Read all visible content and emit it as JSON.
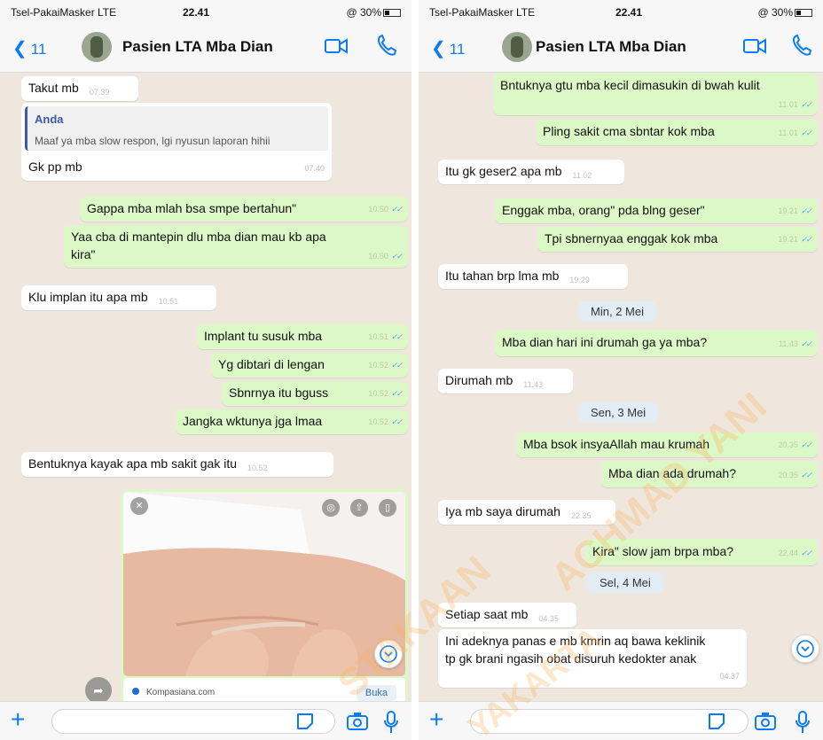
{
  "colors": {
    "accent": "#0b7cf4",
    "bubble_out": "#dcf8c6",
    "bubble_in": "#ffffff",
    "chat_bg": "#efe7de",
    "read_ticks": "#45a6f0"
  },
  "status": {
    "carrier": "Tsel-PakaiMasker  LTE",
    "time": "22.41",
    "battery": "@ 30%"
  },
  "header": {
    "back_count": "11",
    "title": "Pasien LTA Mba Dian"
  },
  "ticks": "✓✓",
  "left": {
    "m1": {
      "text": "Takut mb",
      "time": "07.39"
    },
    "quote": {
      "author": "Anda",
      "text": "Maaf ya mba slow respon, lgi nyusun laporan hihii"
    },
    "m2": {
      "text": "Gk pp mb",
      "time": "07.40"
    },
    "m3": {
      "text": "Gappa mba mlah bsa smpe bertahun\"",
      "time": "10.50"
    },
    "m4": {
      "line1": "Yaa cba di mantepin dlu mba dian mau kb apa",
      "line2": "kira\"",
      "time": "10.50"
    },
    "m5": {
      "text": "Klu implan itu apa mb",
      "time": "10.51"
    },
    "m6": {
      "text": "Implant tu susuk mba",
      "time": "10.51"
    },
    "m7": {
      "text": "Yg dibtari di lengan",
      "time": "10.52"
    },
    "m8": {
      "text": "Sbnrnya itu bguss",
      "time": "10.52"
    },
    "m9": {
      "text": "Jangka wktunya jga lmaa",
      "time": "10.52"
    },
    "m10": {
      "text": "Bentuknya kayak apa mb sakit gak itu",
      "time": "10.52"
    },
    "link": {
      "source": "Kompasiana.com",
      "button": "Buka"
    }
  },
  "right": {
    "r1": {
      "text": "Bntuknya gtu mba kecil dimasukin di bwah kulit",
      "time": "11.01"
    },
    "r2": {
      "text": "Pling sakit cma sbntar kok mba",
      "time": "11.01"
    },
    "r3": {
      "text": "Itu gk geser2 apa mb",
      "time": "11.02"
    },
    "r4": {
      "text": "Enggak mba, orang\" pda blng geser\"",
      "time": "19.21"
    },
    "r5": {
      "text": "Tpi sbnernyaa enggak kok mba",
      "time": "19.21"
    },
    "r6": {
      "text": "Itu tahan brp lma mb",
      "time": "19.29"
    },
    "d1": "Min, 2 Mei",
    "r7": {
      "text": "Mba dian hari ini drumah ga ya mba?",
      "time": "11.43"
    },
    "r8": {
      "text": "Dirumah mb",
      "time": "11.43"
    },
    "d2": "Sen, 3 Mei",
    "r9": {
      "text": "Mba bsok insyaAllah mau krumah",
      "time": "20.35"
    },
    "r10": {
      "text": "Mba dian ada drumah?",
      "time": "20.35"
    },
    "r11": {
      "text": "Iya mb saya dirumah",
      "time": "22.35"
    },
    "r12": {
      "text": "Kira\" slow jam brpa mba?",
      "time": "22.44"
    },
    "d3": "Sel, 4 Mei",
    "r13": {
      "text": "Setiap saat mb",
      "time": "04.35"
    },
    "r14": {
      "line1": "Ini adeknya panas e mb kmrin aq bawa keklinik",
      "line2": "tp gk brani ngasih obat disuruh kedokter anak",
      "time": "04.37"
    }
  },
  "watermark": {
    "line1": "STAKAAN",
    "line2": "ACHMAD YANI",
    "line3": "YAKARTA"
  },
  "icons": [
    "back-chevron-icon",
    "video-call-icon",
    "phone-icon",
    "plus-icon",
    "sticker-icon",
    "camera-icon",
    "microphone-icon",
    "chevron-down-icon",
    "share-icon",
    "close-icon"
  ]
}
